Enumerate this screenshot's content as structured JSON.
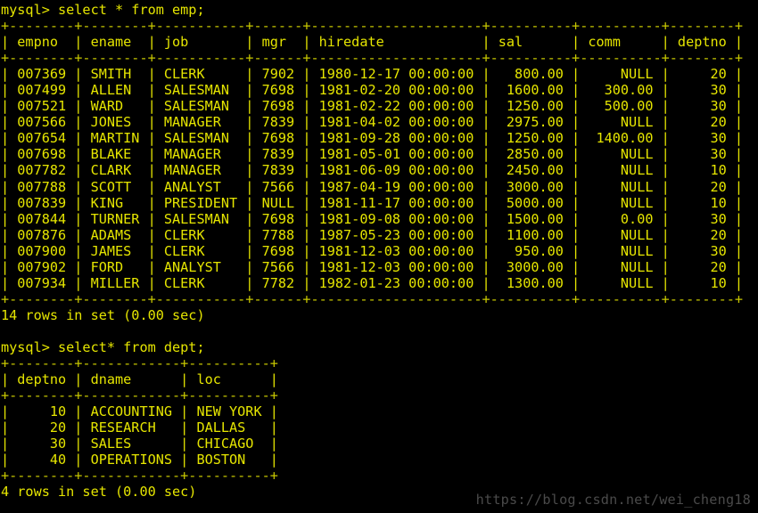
{
  "terminal": {
    "background_color": "#000000",
    "text_color": "#e5e500",
    "rule_color": "#c8c800",
    "watermark_color": "#4a4a4a",
    "prompt": "mysql>"
  },
  "watermark": {
    "text": "https://blog.csdn.net/wei_cheng18"
  },
  "queries": [
    {
      "command_line": "mysql> select * from emp;",
      "command": "select * from emp;",
      "result_footer": "14 rows in set (0.00 sec)",
      "row_count": 14,
      "elapsed": "0.00 sec",
      "table": {
        "columns": [
          {
            "name": "empno",
            "width": 8,
            "align": "right"
          },
          {
            "name": "ename",
            "width": 8,
            "align": "left"
          },
          {
            "name": "job",
            "width": 11,
            "align": "left"
          },
          {
            "name": "mgr",
            "width": 6,
            "align": "right"
          },
          {
            "name": "hiredate",
            "width": 21,
            "align": "left"
          },
          {
            "name": "sal",
            "width": 10,
            "align": "right"
          },
          {
            "name": "comm",
            "width": 10,
            "align": "right"
          },
          {
            "name": "deptno",
            "width": 8,
            "align": "right"
          }
        ],
        "rows": [
          [
            "007369",
            "SMITH",
            "CLERK",
            "7902",
            "1980-12-17 00:00:00",
            "800.00",
            "NULL",
            "20"
          ],
          [
            "007499",
            "ALLEN",
            "SALESMAN",
            "7698",
            "1981-02-20 00:00:00",
            "1600.00",
            "300.00",
            "30"
          ],
          [
            "007521",
            "WARD",
            "SALESMAN",
            "7698",
            "1981-02-22 00:00:00",
            "1250.00",
            "500.00",
            "30"
          ],
          [
            "007566",
            "JONES",
            "MANAGER",
            "7839",
            "1981-04-02 00:00:00",
            "2975.00",
            "NULL",
            "20"
          ],
          [
            "007654",
            "MARTIN",
            "SALESMAN",
            "7698",
            "1981-09-28 00:00:00",
            "1250.00",
            "1400.00",
            "30"
          ],
          [
            "007698",
            "BLAKE",
            "MANAGER",
            "7839",
            "1981-05-01 00:00:00",
            "2850.00",
            "NULL",
            "30"
          ],
          [
            "007782",
            "CLARK",
            "MANAGER",
            "7839",
            "1981-06-09 00:00:00",
            "2450.00",
            "NULL",
            "10"
          ],
          [
            "007788",
            "SCOTT",
            "ANALYST",
            "7566",
            "1987-04-19 00:00:00",
            "3000.00",
            "NULL",
            "20"
          ],
          [
            "007839",
            "KING",
            "PRESIDENT",
            "NULL",
            "1981-11-17 00:00:00",
            "5000.00",
            "NULL",
            "10"
          ],
          [
            "007844",
            "TURNER",
            "SALESMAN",
            "7698",
            "1981-09-08 00:00:00",
            "1500.00",
            "0.00",
            "30"
          ],
          [
            "007876",
            "ADAMS",
            "CLERK",
            "7788",
            "1987-05-23 00:00:00",
            "1100.00",
            "NULL",
            "20"
          ],
          [
            "007900",
            "JAMES",
            "CLERK",
            "7698",
            "1981-12-03 00:00:00",
            "950.00",
            "NULL",
            "30"
          ],
          [
            "007902",
            "FORD",
            "ANALYST",
            "7566",
            "1981-12-03 00:00:00",
            "3000.00",
            "NULL",
            "20"
          ],
          [
            "007934",
            "MILLER",
            "CLERK",
            "7782",
            "1982-01-23 00:00:00",
            "1300.00",
            "NULL",
            "10"
          ]
        ]
      }
    },
    {
      "command_line": "mysql> select* from dept;",
      "command": "select* from dept;",
      "result_footer": "4 rows in set (0.00 sec)",
      "row_count": 4,
      "elapsed": "0.00 sec",
      "table": {
        "columns": [
          {
            "name": "deptno",
            "width": 8,
            "align": "right"
          },
          {
            "name": "dname",
            "width": 12,
            "align": "left"
          },
          {
            "name": "loc",
            "width": 10,
            "align": "left"
          }
        ],
        "rows": [
          [
            "10",
            "ACCOUNTING",
            "NEW YORK"
          ],
          [
            "20",
            "RESEARCH",
            "DALLAS"
          ],
          [
            "30",
            "SALES",
            "CHICAGO"
          ],
          [
            "40",
            "OPERATIONS",
            "BOSTON"
          ]
        ]
      }
    }
  ]
}
